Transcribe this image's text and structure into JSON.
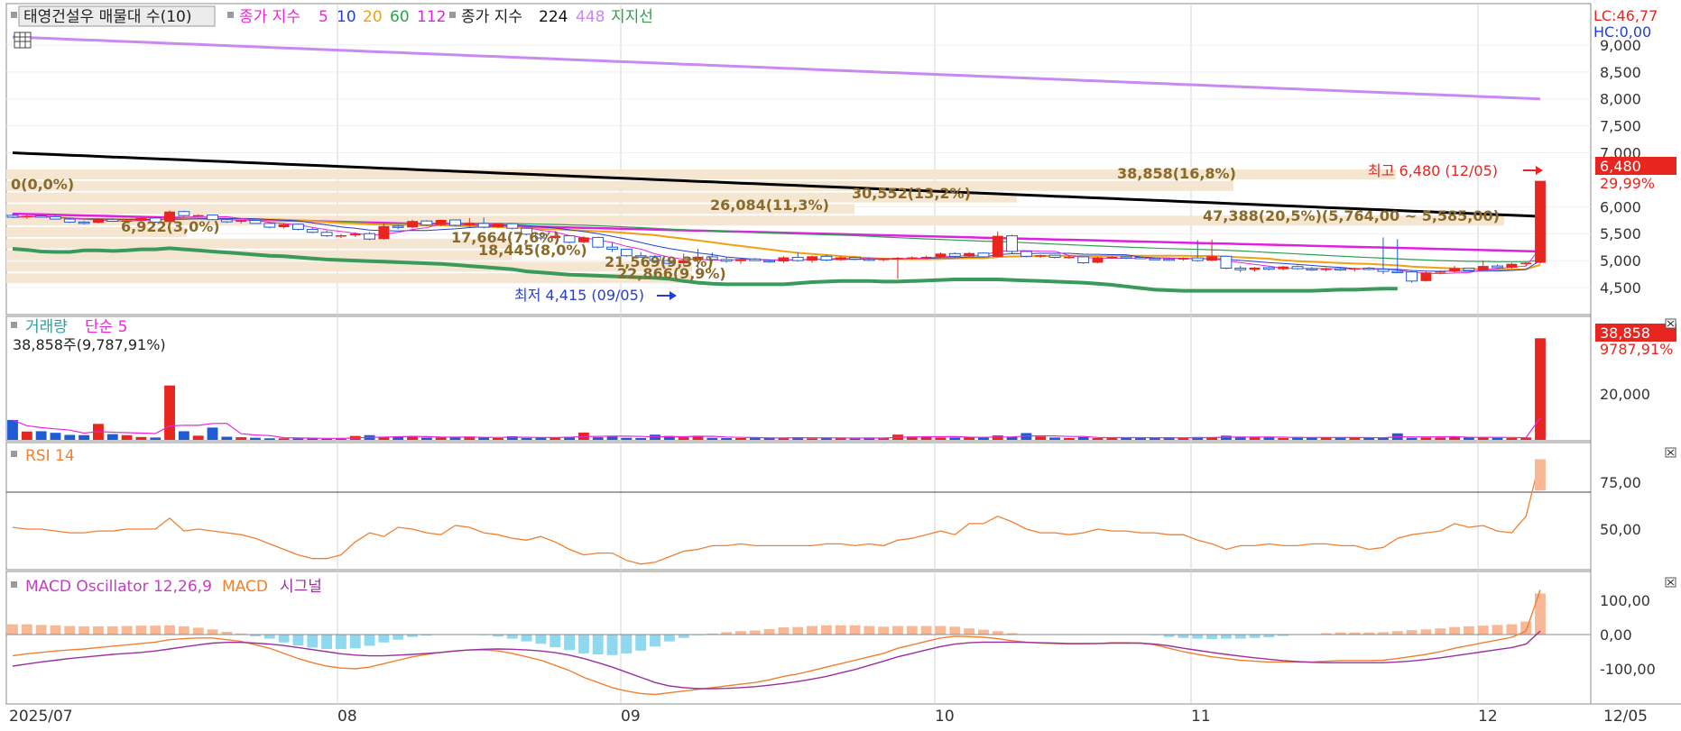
{
  "colors": {
    "bg": "#ffffff",
    "frame": "#7f7f7f",
    "grid": "#d4d4d4",
    "up": "#e8251f",
    "down": "#1f5bd6",
    "ma5": "#e828d8",
    "ma10": "#2540d0",
    "ma20": "#f0a010",
    "ma60": "#30a050",
    "ma112": "#e020e0",
    "ma224": "#000000",
    "ma448": "#c88af0",
    "support": "#3a9a5a",
    "volband": "#f5e6d2",
    "rsi": "#f08030",
    "macd": "#f08030",
    "signal": "#9a30a0",
    "osc_pos": "#f8b896",
    "osc_neg": "#8ed8f0",
    "annot": "#8a6a2a"
  },
  "price_panel": {
    "legend": {
      "name": "태영건설우 매물대 수(10)",
      "close_label": "종가 지수",
      "close_periods": [
        "5",
        "10",
        "20",
        "60",
        "112"
      ],
      "close_label2": "종가 지수",
      "close_periods2": [
        "224",
        "448"
      ],
      "support": "지지선"
    },
    "lc": "LC:46,77",
    "hc": "HC:0,00",
    "y_ticks": [
      "9,000",
      "8,500",
      "8,000",
      "7,500",
      "7,000",
      "6,000",
      "5,500",
      "5,000",
      "4,500"
    ],
    "current_price": "6,480",
    "current_change": "29,99%",
    "high_label": "최고 6,480 (12/05)",
    "low_label": "최저 4,415 (09/05)",
    "volume_profile": [
      "0(0,0%)",
      "38,858(16,8%)",
      "30,552(13,2%)",
      "26,084(11,3%)",
      "47,388(20,5%)(5,764,00 ~ 5,585,00)",
      "6,922(3,0%)",
      "17,664(7,6%)",
      "18,445(8,0%)",
      "21,569(9,3%)",
      "22,866(9,9%)"
    ]
  },
  "volume_panel": {
    "legend": {
      "name": "거래량",
      "ma": "단순 5"
    },
    "info": "38,858주(9,787,91%)",
    "last_value": "38,858",
    "last_pct": "9787,91%",
    "y_ticks": [
      "20,000"
    ]
  },
  "rsi_panel": {
    "legend": "RSI 14",
    "y_ticks": [
      "75,00",
      "50,00"
    ]
  },
  "macd_panel": {
    "legend": {
      "osc": "MACD Oscillator 12,26,9",
      "macd": "MACD",
      "signal": "시그널"
    },
    "y_ticks": [
      "100,00",
      "0,00",
      "-100,00"
    ]
  },
  "x_axis": {
    "labels": [
      "2025/07",
      "08",
      "09",
      "10",
      "11",
      "12"
    ],
    "last_date": "12/05"
  },
  "chart_data": {
    "type": "candlestick",
    "n_sessions": 108,
    "price_range": [
      4450,
      9200
    ],
    "candles": [
      [
        5840,
        5865,
        5790,
        5805
      ],
      [
        5805,
        5845,
        5775,
        5830
      ],
      [
        5830,
        5860,
        5805,
        5815
      ],
      [
        5815,
        5830,
        5760,
        5770
      ],
      [
        5770,
        5795,
        5700,
        5715
      ],
      [
        5715,
        5740,
        5670,
        5700
      ],
      [
        5700,
        5785,
        5690,
        5765
      ],
      [
        5765,
        5790,
        5720,
        5730
      ],
      [
        5730,
        5760,
        5700,
        5745
      ],
      [
        5745,
        5800,
        5730,
        5790
      ],
      [
        5790,
        5810,
        5700,
        5715
      ],
      [
        5715,
        5930,
        5710,
        5910
      ],
      [
        5910,
        5925,
        5815,
        5835
      ],
      [
        5835,
        5860,
        5810,
        5845
      ],
      [
        5845,
        5855,
        5750,
        5760
      ],
      [
        5760,
        5785,
        5700,
        5720
      ],
      [
        5720,
        5760,
        5690,
        5745
      ],
      [
        5745,
        5760,
        5680,
        5690
      ],
      [
        5690,
        5710,
        5600,
        5620
      ],
      [
        5620,
        5690,
        5600,
        5675
      ],
      [
        5675,
        5690,
        5560,
        5580
      ],
      [
        5580,
        5610,
        5510,
        5525
      ],
      [
        5525,
        5560,
        5440,
        5460
      ],
      [
        5460,
        5490,
        5420,
        5470
      ],
      [
        5470,
        5520,
        5440,
        5500
      ],
      [
        5500,
        5530,
        5380,
        5400
      ],
      [
        5400,
        5690,
        5390,
        5640
      ],
      [
        5640,
        5660,
        5580,
        5615
      ],
      [
        5615,
        5760,
        5600,
        5735
      ],
      [
        5735,
        5750,
        5640,
        5660
      ],
      [
        5660,
        5760,
        5640,
        5755
      ],
      [
        5755,
        5760,
        5640,
        5655
      ],
      [
        5655,
        5790,
        5630,
        5690
      ],
      [
        5690,
        5800,
        5600,
        5620
      ],
      [
        5620,
        5700,
        5600,
        5685
      ],
      [
        5685,
        5700,
        5580,
        5600
      ],
      [
        5600,
        5610,
        5470,
        5490
      ],
      [
        5490,
        5500,
        5380,
        5420
      ],
      [
        5420,
        5550,
        5400,
        5460
      ],
      [
        5460,
        5470,
        5320,
        5340
      ],
      [
        5340,
        5450,
        5320,
        5430
      ],
      [
        5430,
        5440,
        5230,
        5250
      ],
      [
        5250,
        5340,
        5160,
        5210
      ],
      [
        5210,
        5220,
        5070,
        5090
      ],
      [
        5090,
        5160,
        5050,
        5080
      ],
      [
        5080,
        5100,
        4980,
        5000
      ],
      [
        5000,
        5040,
        4930,
        4950
      ],
      [
        4950,
        5130,
        4930,
        5010
      ],
      [
        5010,
        5220,
        4860,
        5070
      ],
      [
        5070,
        5150,
        4980,
        5020
      ],
      [
        5020,
        5060,
        4960,
        4990
      ],
      [
        4990,
        5040,
        4940,
        5030
      ],
      [
        5030,
        5050,
        4990,
        5000
      ],
      [
        5000,
        5020,
        4960,
        4985
      ],
      [
        4985,
        5080,
        4960,
        5060
      ],
      [
        5060,
        5150,
        4980,
        5000
      ],
      [
        5000,
        5090,
        4960,
        5080
      ],
      [
        5080,
        5110,
        4990,
        5010
      ],
      [
        5010,
        5080,
        5000,
        5060
      ],
      [
        5060,
        5075,
        5010,
        5030
      ],
      [
        5030,
        5060,
        4990,
        5010
      ],
      [
        5010,
        5045,
        4990,
        5040
      ],
      [
        5040,
        5070,
        4660,
        5050
      ],
      [
        5050,
        5080,
        5020,
        5060
      ],
      [
        5060,
        5090,
        5030,
        5070
      ],
      [
        5070,
        5150,
        5040,
        5130
      ],
      [
        5130,
        5150,
        5060,
        5080
      ],
      [
        5080,
        5160,
        5060,
        5140
      ],
      [
        5140,
        5150,
        5060,
        5070
      ],
      [
        5070,
        5540,
        5060,
        5460
      ],
      [
        5460,
        5480,
        5120,
        5170
      ],
      [
        5170,
        5180,
        5060,
        5080
      ],
      [
        5080,
        5110,
        5050,
        5100
      ],
      [
        5100,
        5110,
        5040,
        5060
      ],
      [
        5060,
        5100,
        5040,
        5070
      ],
      [
        5070,
        5080,
        4940,
        4960
      ],
      [
        4960,
        5070,
        4950,
        5060
      ],
      [
        5060,
        5080,
        5040,
        5070
      ],
      [
        5070,
        5080,
        5030,
        5060
      ],
      [
        5060,
        5070,
        5030,
        5040
      ],
      [
        5040,
        5060,
        5020,
        5030
      ],
      [
        5030,
        5050,
        5000,
        5020
      ],
      [
        5020,
        5060,
        5000,
        5050
      ],
      [
        5050,
        5380,
        4980,
        5000
      ],
      [
        5000,
        5390,
        4990,
        5080
      ],
      [
        5080,
        5090,
        4840,
        4860
      ],
      [
        4860,
        4900,
        4790,
        4830
      ],
      [
        4830,
        4880,
        4800,
        4870
      ],
      [
        4870,
        4880,
        4820,
        4840
      ],
      [
        4840,
        4900,
        4820,
        4890
      ],
      [
        4890,
        4910,
        4830,
        4850
      ],
      [
        4850,
        4880,
        4810,
        4830
      ],
      [
        4830,
        4870,
        4800,
        4850
      ],
      [
        4850,
        4870,
        4810,
        4840
      ],
      [
        4840,
        4870,
        4800,
        4860
      ],
      [
        4860,
        4880,
        4820,
        4840
      ],
      [
        4840,
        5430,
        4750,
        4800
      ],
      [
        4800,
        5400,
        4790,
        4790
      ],
      [
        4790,
        4810,
        4590,
        4620
      ],
      [
        4620,
        4800,
        4610,
        4780
      ],
      [
        4780,
        4820,
        4760,
        4800
      ],
      [
        4800,
        4900,
        4780,
        4860
      ],
      [
        4860,
        4870,
        4800,
        4820
      ],
      [
        4820,
        5000,
        4800,
        4900
      ],
      [
        4900,
        4930,
        4850,
        4870
      ],
      [
        4870,
        4960,
        4850,
        4940
      ],
      [
        4940,
        4970,
        4890,
        4960
      ],
      [
        4960,
        6480,
        4940,
        6480
      ]
    ],
    "volume": [
      7600,
      3200,
      3300,
      2700,
      1900,
      1800,
      6100,
      2200,
      1800,
      1100,
      900,
      20800,
      3300,
      1600,
      4700,
      1200,
      1000,
      800,
      600,
      600,
      600,
      700,
      400,
      400,
      1500,
      1800,
      1000,
      1300,
      1200,
      900,
      900,
      900,
      1300,
      900,
      700,
      1400,
      700,
      900,
      800,
      1200,
      2800,
      1000,
      1200,
      800,
      700,
      2000,
      1500,
      1000,
      1600,
      800,
      700,
      700,
      700,
      900,
      800,
      1000,
      600,
      700,
      700,
      500,
      900,
      700,
      2000,
      1300,
      1100,
      900,
      900,
      900,
      1100,
      1700,
      1100,
      2600,
      1300,
      900,
      700,
      1100,
      700,
      900,
      900,
      700,
      900,
      700,
      800,
      1100,
      900,
      1600,
      900,
      900,
      1100,
      700,
      1100,
      900,
      900,
      900,
      900,
      700,
      800,
      2500,
      800,
      900,
      900,
      1300,
      900,
      900,
      800,
      700,
      900,
      38858
    ],
    "rsi": [
      50,
      49,
      49,
      48,
      47,
      47,
      48,
      48,
      49,
      49,
      49,
      55,
      48,
      49,
      48,
      47,
      46,
      44,
      41,
      38,
      35,
      33,
      33,
      35,
      42,
      47,
      45,
      50,
      49,
      47,
      46,
      51,
      50,
      47,
      46,
      44,
      43,
      45,
      42,
      38,
      35,
      36,
      36,
      32,
      30,
      31,
      34,
      37,
      38,
      40,
      40,
      41,
      40,
      40,
      40,
      40,
      40,
      41,
      41,
      40,
      41,
      40,
      43,
      44,
      46,
      48,
      46,
      52,
      52,
      56,
      53,
      49,
      47,
      47,
      46,
      47,
      49,
      48,
      48,
      47,
      47,
      46,
      46,
      43,
      41,
      38,
      40,
      40,
      41,
      40,
      40,
      41,
      41,
      40,
      40,
      38,
      39,
      44,
      46,
      47,
      48,
      52,
      50,
      51,
      48,
      47,
      56,
      87
    ],
    "macd": [
      -62,
      -56,
      -52,
      -48,
      -45,
      -42,
      -38,
      -34,
      -30,
      -26,
      -22,
      -15,
      -12,
      -10,
      -10,
      -15,
      -20,
      -30,
      -40,
      -55,
      -70,
      -82,
      -92,
      -98,
      -100,
      -95,
      -85,
      -75,
      -65,
      -58,
      -52,
      -48,
      -45,
      -45,
      -48,
      -55,
      -65,
      -75,
      -90,
      -105,
      -125,
      -140,
      -155,
      -165,
      -172,
      -175,
      -170,
      -165,
      -160,
      -155,
      -150,
      -145,
      -140,
      -132,
      -122,
      -115,
      -105,
      -95,
      -85,
      -75,
      -65,
      -55,
      -40,
      -30,
      -20,
      -10,
      -5,
      -6,
      -8,
      -12,
      -18,
      -22,
      -25,
      -26,
      -27,
      -27,
      -26,
      -24,
      -24,
      -25,
      -30,
      -40,
      -50,
      -58,
      -65,
      -70,
      -75,
      -78,
      -80,
      -80,
      -80,
      -80,
      -78,
      -76,
      -76,
      -76,
      -75,
      -70,
      -64,
      -58,
      -50,
      -40,
      -32,
      -24,
      -16,
      -8,
      10,
      130
    ],
    "signal": [
      -92,
      -86,
      -80,
      -75,
      -70,
      -66,
      -62,
      -58,
      -55,
      -52,
      -48,
      -42,
      -36,
      -30,
      -25,
      -23,
      -23,
      -25,
      -28,
      -32,
      -38,
      -44,
      -50,
      -56,
      -60,
      -62,
      -62,
      -60,
      -58,
      -55,
      -52,
      -48,
      -45,
      -43,
      -42,
      -43,
      -45,
      -48,
      -53,
      -60,
      -70,
      -82,
      -95,
      -110,
      -125,
      -140,
      -150,
      -155,
      -158,
      -158,
      -157,
      -155,
      -152,
      -148,
      -143,
      -137,
      -130,
      -122,
      -112,
      -102,
      -90,
      -78,
      -65,
      -55,
      -45,
      -35,
      -28,
      -24,
      -22,
      -22,
      -22,
      -23,
      -24,
      -25,
      -26,
      -26,
      -26,
      -25,
      -25,
      -25,
      -28,
      -33,
      -40,
      -46,
      -52,
      -58,
      -63,
      -68,
      -72,
      -76,
      -79,
      -81,
      -82,
      -82,
      -82,
      -82,
      -82,
      -80,
      -77,
      -73,
      -68,
      -62,
      -56,
      -50,
      -44,
      -38,
      -28,
      10
    ],
    "support": [
      5220,
      5200,
      5170,
      5160,
      5160,
      5190,
      5190,
      5180,
      5190,
      5210,
      5210,
      5230,
      5210,
      5190,
      5170,
      5150,
      5130,
      5110,
      5090,
      5080,
      5060,
      5040,
      5020,
      5010,
      5000,
      4990,
      4980,
      4970,
      4960,
      4950,
      4940,
      4920,
      4900,
      4880,
      4860,
      4840,
      4800,
      4780,
      4760,
      4740,
      4730,
      4720,
      4710,
      4700,
      4690,
      4680,
      4660,
      4620,
      4590,
      4570,
      4560,
      4560,
      4560,
      4560,
      4560,
      4580,
      4600,
      4610,
      4620,
      4620,
      4620,
      4610,
      4610,
      4620,
      4630,
      4640,
      4650,
      4650,
      4650,
      4650,
      4640,
      4630,
      4620,
      4610,
      4600,
      4590,
      4570,
      4550,
      4520,
      4490,
      4460,
      4450,
      4440,
      4440,
      4440,
      4440,
      4440,
      4440,
      4440,
      4440,
      4440,
      4440,
      4450,
      4460,
      4460,
      4470,
      4480,
      4480
    ]
  }
}
